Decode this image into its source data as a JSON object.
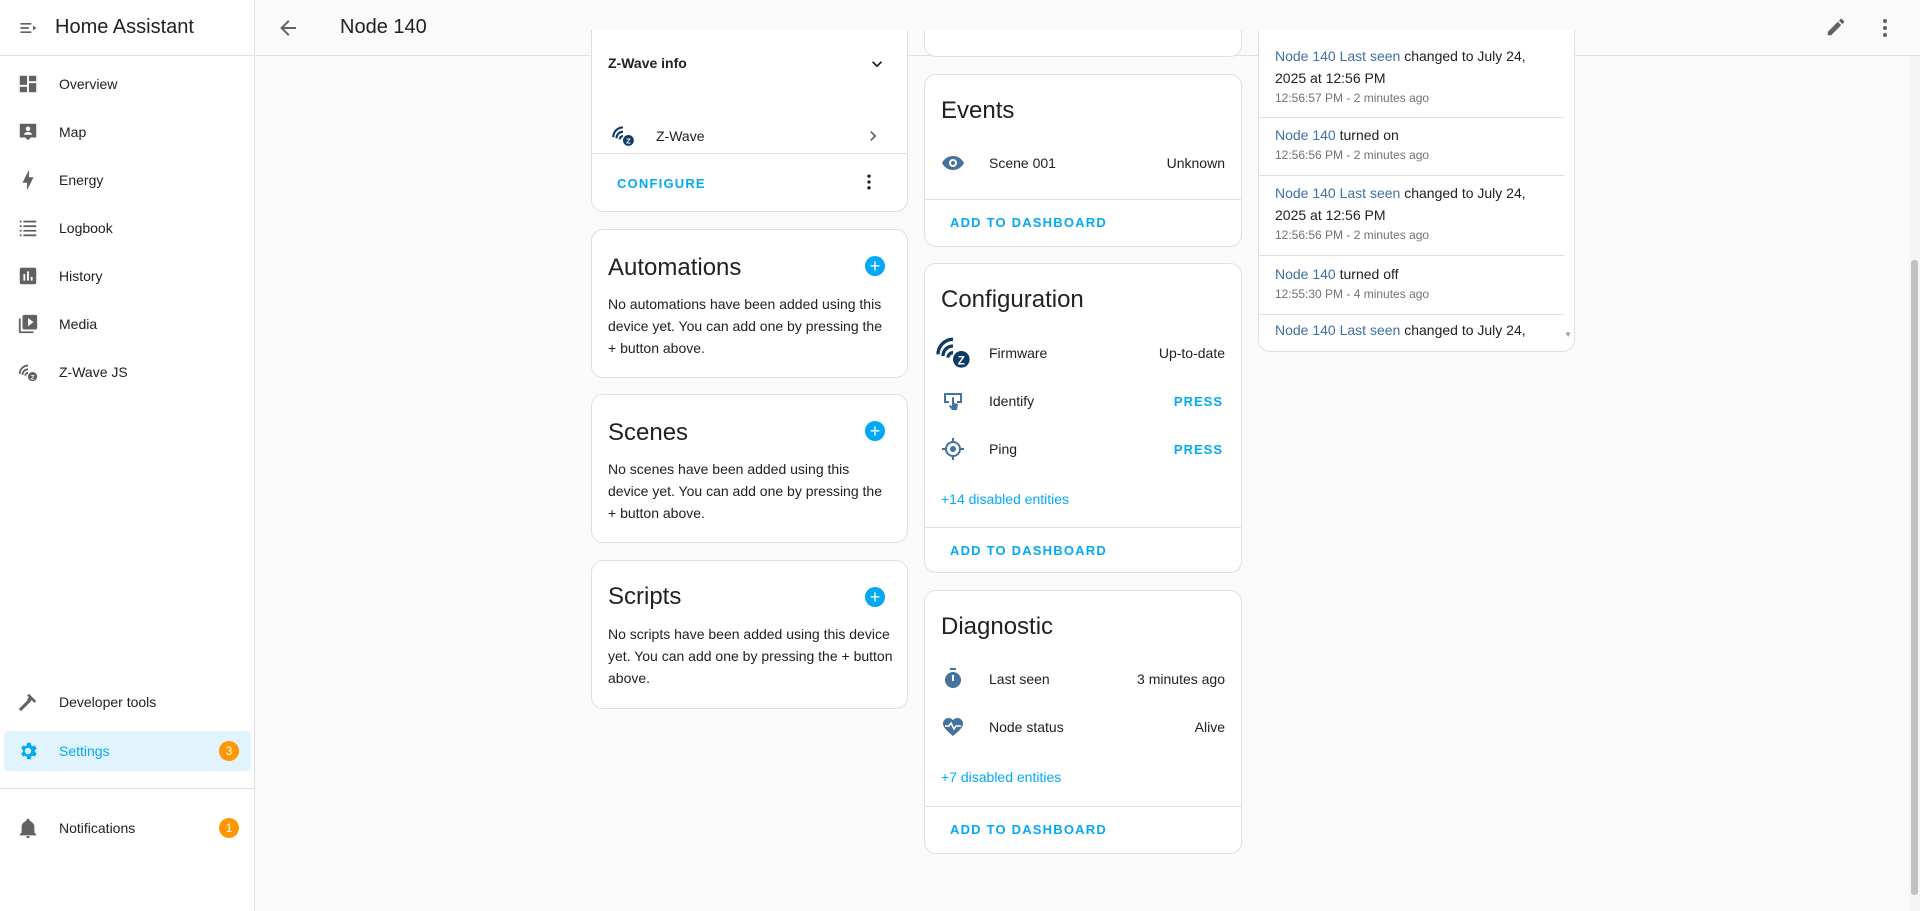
{
  "app": {
    "title": "Home Assistant"
  },
  "sidebar": {
    "items": [
      {
        "label": "Overview",
        "icon": "view-dashboard-icon"
      },
      {
        "label": "Map",
        "icon": "map-icon"
      },
      {
        "label": "Energy",
        "icon": "lightning-bolt-icon"
      },
      {
        "label": "Logbook",
        "icon": "format-list-icon"
      },
      {
        "label": "History",
        "icon": "chart-box-icon"
      },
      {
        "label": "Media",
        "icon": "play-box-multiple-icon"
      },
      {
        "label": "Z-Wave JS",
        "icon": "z-wave-icon"
      }
    ],
    "developer_tools": "Developer tools",
    "settings": {
      "label": "Settings",
      "badge": "3"
    },
    "notifications": {
      "label": "Notifications",
      "badge": "1"
    }
  },
  "header": {
    "title": "Node 140"
  },
  "zwave_card": {
    "title": "Z-Wave info",
    "integration": "Z-Wave",
    "configure": "CONFIGURE"
  },
  "automations": {
    "title": "Automations",
    "body": "No automations have been added using this device yet. You can add one by pressing the + button above."
  },
  "scenes": {
    "title": "Scenes",
    "body": "No scenes have been added using this device yet. You can add one by pressing the + button above."
  },
  "scripts": {
    "title": "Scripts",
    "body": "No scripts have been added using this device yet. You can add one by pressing the + button above."
  },
  "events": {
    "title": "Events",
    "rows": [
      {
        "name": "Scene 001",
        "value": "Unknown"
      }
    ],
    "action": "ADD TO DASHBOARD"
  },
  "configuration": {
    "title": "Configuration",
    "rows": [
      {
        "name": "Firmware",
        "value": "Up-to-date"
      },
      {
        "name": "Identify",
        "value": "PRESS"
      },
      {
        "name": "Ping",
        "value": "PRESS"
      }
    ],
    "disabled": "+14 disabled entities",
    "action": "ADD TO DASHBOARD"
  },
  "diagnostic": {
    "title": "Diagnostic",
    "rows": [
      {
        "name": "Last seen",
        "value": "3 minutes ago"
      },
      {
        "name": "Node status",
        "value": "Alive"
      }
    ],
    "disabled": "+7 disabled entities",
    "action": "ADD TO DASHBOARD"
  },
  "logbook": {
    "entries": [
      {
        "entity": "Node 140 Last seen",
        "text1": " changed to July 24,",
        "text2": "2025 at 12:56 PM",
        "time": "12:56:57 PM - 2 minutes ago"
      },
      {
        "entity": "Node 140",
        "text1": " turned on",
        "text2": "",
        "time": "12:56:56 PM - 2 minutes ago"
      },
      {
        "entity": "Node 140 Last seen",
        "text1": " changed to July 24,",
        "text2": "2025 at 12:56 PM",
        "time": "12:56:56 PM - 2 minutes ago"
      },
      {
        "entity": "Node 140",
        "text1": " turned off",
        "text2": "",
        "time": "12:55:30 PM - 4 minutes ago"
      },
      {
        "entity": "Node 140 Last seen",
        "text1": " changed to July 24,",
        "text2": "",
        "time": ""
      }
    ]
  },
  "colors": {
    "accent": "#03a9f4",
    "badge": "#ff9800",
    "zwave": "#0d3b66"
  }
}
